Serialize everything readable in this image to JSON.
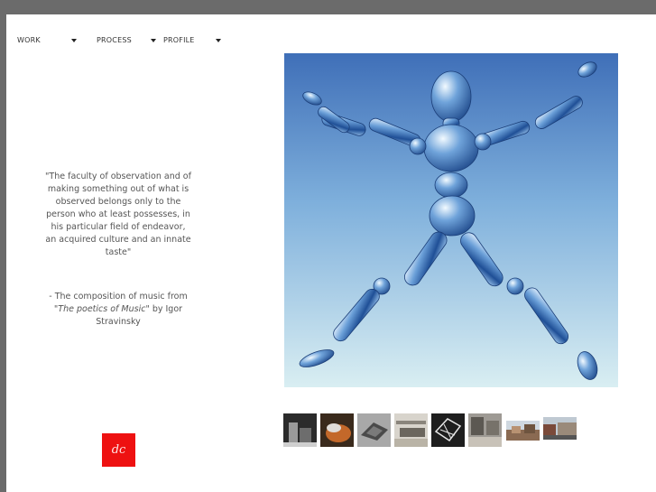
{
  "nav": {
    "items": [
      {
        "label": "WORK"
      },
      {
        "label": "PROCESS"
      },
      {
        "label": "PROFILE"
      }
    ]
  },
  "quote": {
    "text": "\"The faculty of observation and of making something out of what is observed belongs only to the person who at least possesses, in his particular field of endeavor, an acquired culture and an innate taste\""
  },
  "attribution": {
    "prefix": "- The composition of music from \"",
    "work": "The poetics of Music",
    "suffix": "\" by Igor Stravinsky"
  },
  "logo": {
    "text": "dc",
    "color": "#ee1111"
  },
  "hero": {
    "icon": "mannequin-figure-image",
    "sky_top": "#4a7bc0",
    "sky_bottom": "#d6ecf2"
  },
  "thumbnails": [
    {
      "name": "thumb-1"
    },
    {
      "name": "thumb-2"
    },
    {
      "name": "thumb-3"
    },
    {
      "name": "thumb-4"
    },
    {
      "name": "thumb-5"
    },
    {
      "name": "thumb-6"
    },
    {
      "name": "thumb-7"
    },
    {
      "name": "thumb-8"
    }
  ]
}
